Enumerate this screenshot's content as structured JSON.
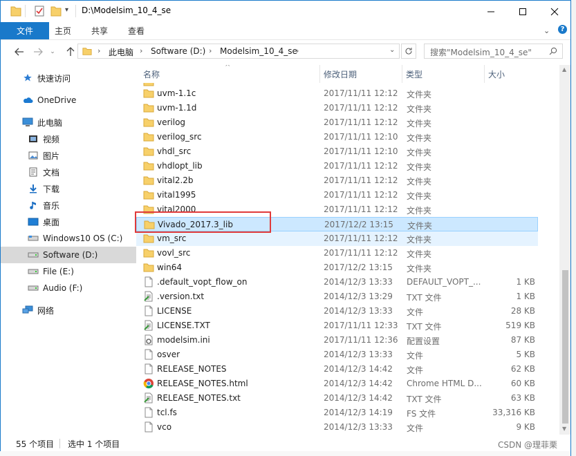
{
  "titlebar": {
    "path_title": "D:\\Modelsim_10_4_se",
    "minimize_icon": "minimize-icon",
    "maximize_icon": "maximize-icon",
    "close_icon": "close-icon"
  },
  "ribbon": {
    "tabs": [
      {
        "label": "文件"
      },
      {
        "label": "主页"
      },
      {
        "label": "共享"
      },
      {
        "label": "查看"
      }
    ]
  },
  "address": {
    "segments": [
      "此电脑",
      "Software (D:)",
      "Modelsim_10_4_se"
    ],
    "search_placeholder": "搜索\"Modelsim_10_4_se\""
  },
  "nav": {
    "items": [
      {
        "label": "快速访问",
        "icon": "star-icon"
      },
      {
        "label": "OneDrive",
        "icon": "cloud-icon"
      },
      {
        "label": "此电脑",
        "icon": "computer-icon"
      },
      {
        "label": "视频",
        "icon": "video-icon"
      },
      {
        "label": "图片",
        "icon": "picture-icon"
      },
      {
        "label": "文档",
        "icon": "document-icon"
      },
      {
        "label": "下载",
        "icon": "download-icon"
      },
      {
        "label": "音乐",
        "icon": "music-icon"
      },
      {
        "label": "桌面",
        "icon": "desktop-icon"
      },
      {
        "label": "Windows10 OS (C:)",
        "icon": "drive-icon"
      },
      {
        "label": "Software (D:)",
        "icon": "drive-icon"
      },
      {
        "label": "File (E:)",
        "icon": "drive-icon"
      },
      {
        "label": "Audio (F:)",
        "icon": "drive-icon"
      },
      {
        "label": "网络",
        "icon": "network-icon"
      }
    ]
  },
  "columns": {
    "name": "名称",
    "date": "修改日期",
    "type": "类型",
    "size": "大小"
  },
  "files": [
    {
      "name": "uvm-1.1c",
      "date": "2017/11/11 12:12",
      "type": "文件夹",
      "size": "",
      "icon": "folder-icon"
    },
    {
      "name": "uvm-1.1d",
      "date": "2017/11/11 12:12",
      "type": "文件夹",
      "size": "",
      "icon": "folder-icon"
    },
    {
      "name": "verilog",
      "date": "2017/11/11 12:12",
      "type": "文件夹",
      "size": "",
      "icon": "folder-icon"
    },
    {
      "name": "verilog_src",
      "date": "2017/11/11 12:10",
      "type": "文件夹",
      "size": "",
      "icon": "folder-icon"
    },
    {
      "name": "vhdl_src",
      "date": "2017/11/11 12:10",
      "type": "文件夹",
      "size": "",
      "icon": "folder-icon"
    },
    {
      "name": "vhdlopt_lib",
      "date": "2017/11/11 12:12",
      "type": "文件夹",
      "size": "",
      "icon": "folder-icon"
    },
    {
      "name": "vital2.2b",
      "date": "2017/11/11 12:12",
      "type": "文件夹",
      "size": "",
      "icon": "folder-icon"
    },
    {
      "name": "vital1995",
      "date": "2017/11/11 12:12",
      "type": "文件夹",
      "size": "",
      "icon": "folder-icon"
    },
    {
      "name": "vital2000",
      "date": "2017/11/11 12:12",
      "type": "文件夹",
      "size": "",
      "icon": "folder-icon"
    },
    {
      "name": "Vivado_2017.3_lib",
      "date": "2017/12/2 13:15",
      "type": "文件夹",
      "size": "",
      "icon": "folder-icon"
    },
    {
      "name": "vm_src",
      "date": "2017/11/11 12:12",
      "type": "文件夹",
      "size": "",
      "icon": "folder-icon"
    },
    {
      "name": "vovl_src",
      "date": "2017/11/11 12:12",
      "type": "文件夹",
      "size": "",
      "icon": "folder-icon"
    },
    {
      "name": "win64",
      "date": "2017/12/2 13:15",
      "type": "文件夹",
      "size": "",
      "icon": "folder-icon"
    },
    {
      "name": ".default_vopt_flow_on",
      "date": "2014/12/3 13:33",
      "type": "DEFAULT_VOPT_...",
      "size": "1 KB",
      "icon": "blank-file-icon"
    },
    {
      "name": ".version.txt",
      "date": "2014/12/3 13:29",
      "type": "TXT 文件",
      "size": "1 KB",
      "icon": "text-file-icon"
    },
    {
      "name": "LICENSE",
      "date": "2014/12/3 13:33",
      "type": "文件",
      "size": "28 KB",
      "icon": "blank-file-icon"
    },
    {
      "name": "LICENSE.TXT",
      "date": "2017/11/11 12:33",
      "type": "TXT 文件",
      "size": "519 KB",
      "icon": "text-file-icon"
    },
    {
      "name": "modelsim.ini",
      "date": "2017/11/11 12:36",
      "type": "配置设置",
      "size": "87 KB",
      "icon": "settings-file-icon"
    },
    {
      "name": "osver",
      "date": "2014/12/3 13:33",
      "type": "文件",
      "size": "5 KB",
      "icon": "blank-file-icon"
    },
    {
      "name": "RELEASE_NOTES",
      "date": "2014/12/3 14:42",
      "type": "文件",
      "size": "62 KB",
      "icon": "blank-file-icon"
    },
    {
      "name": "RELEASE_NOTES.html",
      "date": "2014/12/3 14:42",
      "type": "Chrome HTML D...",
      "size": "60 KB",
      "icon": "chrome-icon"
    },
    {
      "name": "RELEASE_NOTES.txt",
      "date": "2014/12/3 14:42",
      "type": "TXT 文件",
      "size": "63 KB",
      "icon": "text-file-icon"
    },
    {
      "name": "tcl.fs",
      "date": "2014/12/3 14:19",
      "type": "FS 文件",
      "size": "33,316 KB",
      "icon": "blank-file-icon"
    },
    {
      "name": "vco",
      "date": "2014/12/3 13:33",
      "type": "文件",
      "size": "9 KB",
      "icon": "blank-file-icon"
    }
  ],
  "status": {
    "count": "55 个项目",
    "selected": "选中 1 个项目"
  },
  "watermark": "CSDN @理菲栗",
  "colors": {
    "accent": "#1979ca",
    "selection": "#cce8ff",
    "highlight_box": "#e03a3a"
  }
}
